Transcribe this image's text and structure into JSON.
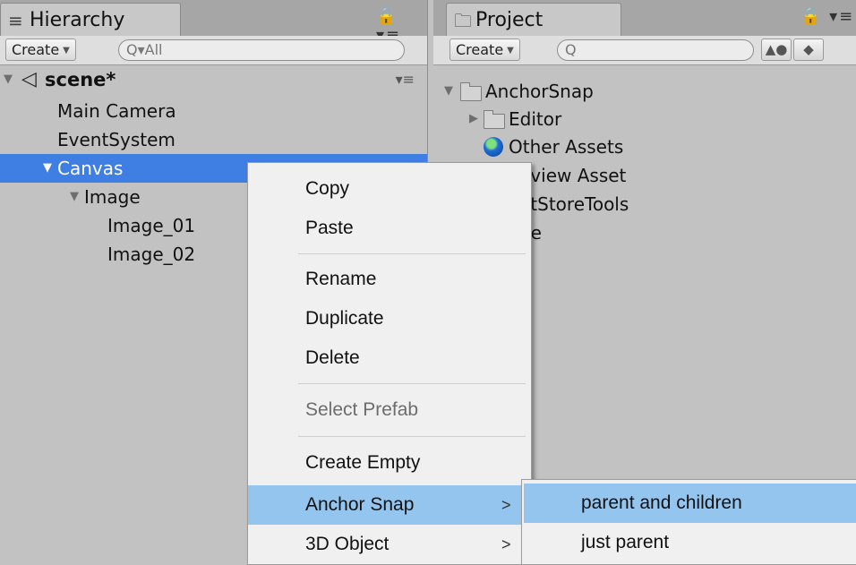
{
  "hierarchy": {
    "tab_icon": "≡",
    "tab_label": "Hierarchy",
    "tools": "🔒 ▾≡",
    "create_label": "Create",
    "search_prefix": "Q▾",
    "search_value": "All",
    "scene_label": "scene*",
    "row_menu": "▾≡",
    "rows": [
      {
        "label": "Main Camera"
      },
      {
        "label": "EventSystem"
      },
      {
        "label": "Canvas"
      },
      {
        "label": "Image"
      },
      {
        "label": "Image_01"
      },
      {
        "label": "Image_02"
      }
    ]
  },
  "project": {
    "tab_icon": "🗀",
    "tab_label": "Project",
    "tools": "🔒 ▾≡",
    "create_label": "Create",
    "search_prefix": "Q",
    "rows": [
      {
        "label": "AnchorSnap"
      },
      {
        "label": "Editor"
      },
      {
        "label": "Other Assets"
      },
      {
        "label": "eview Asset"
      },
      {
        "label": "etStoreTools"
      },
      {
        "label": "ne"
      }
    ]
  },
  "context_menu": {
    "items": [
      {
        "label": "Copy"
      },
      {
        "label": "Paste"
      },
      {
        "label": "Rename"
      },
      {
        "label": "Duplicate"
      },
      {
        "label": "Delete"
      },
      {
        "label": "Select Prefab"
      },
      {
        "label": "Create Empty"
      },
      {
        "label": "Anchor Snap",
        "arrow": ">"
      },
      {
        "label": "3D Object",
        "arrow": ">"
      }
    ]
  },
  "submenu": {
    "items": [
      {
        "label": "parent and children"
      },
      {
        "label": "just parent"
      }
    ]
  },
  "colors": {
    "selection": "#3f7ee3",
    "menu_highlight": "#94c5ef",
    "panel_bg": "#c2c2c2"
  }
}
